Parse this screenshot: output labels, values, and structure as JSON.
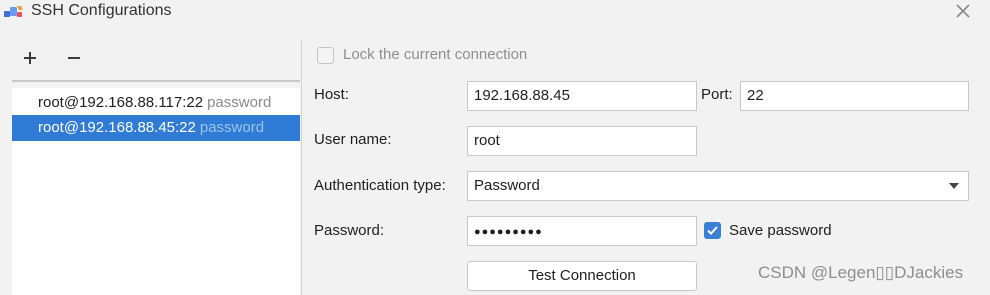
{
  "window": {
    "title": "SSH Configurations"
  },
  "toolbar": {
    "add_label": "+",
    "remove_label": "−"
  },
  "connections": [
    {
      "host": "root@192.168.88.117:22",
      "auth": "password",
      "selected": false
    },
    {
      "host": "root@192.168.88.45:22",
      "auth": "password",
      "selected": true
    }
  ],
  "form": {
    "lock_label": "Lock the current connection",
    "lock_checked": false,
    "host_label": "Host:",
    "host_value": "192.168.88.45",
    "port_label": "Port:",
    "port_value": "22",
    "username_label": "User name:",
    "username_value": "root",
    "auth_type_label": "Authentication type:",
    "auth_type_value": "Password",
    "password_label": "Password:",
    "password_mask": "●●●●●●●●●",
    "save_password_label": "Save password",
    "save_password_checked": true,
    "test_button_label": "Test Connection"
  },
  "watermark": "CSDN @Legen▯▯DJackies",
  "colors": {
    "selection": "#2f7bd6",
    "checkbox_checked": "#3a7fd6",
    "muted_text": "#8e8e8e"
  },
  "icons": {
    "app": "pycharm-remote-icon",
    "close": "close-icon",
    "check": "check-icon",
    "dropdown": "chevron-down-icon"
  }
}
